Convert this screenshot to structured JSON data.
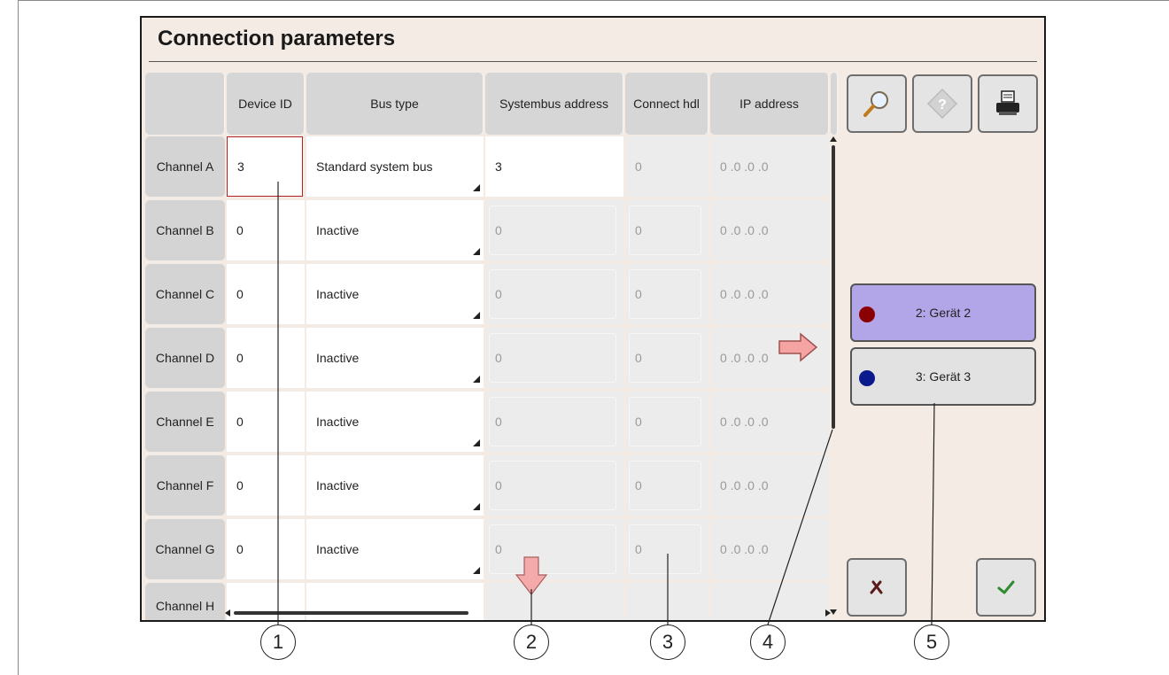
{
  "title": "Connection parameters",
  "columns": [
    "Device ID",
    "Bus type",
    "Systembus address",
    "Connect hdl",
    "IP address"
  ],
  "rows": [
    {
      "channel": "Channel A",
      "device_id": "3",
      "bus_type": "Standard system bus",
      "systembus_address": "3",
      "connect_hdl": "0",
      "ip_address": "0 .0 .0 .0"
    },
    {
      "channel": "Channel B",
      "device_id": "0",
      "bus_type": "Inactive",
      "systembus_address": "0",
      "connect_hdl": "0",
      "ip_address": "0 .0 .0 .0"
    },
    {
      "channel": "Channel C",
      "device_id": "0",
      "bus_type": "Inactive",
      "systembus_address": "0",
      "connect_hdl": "0",
      "ip_address": "0 .0 .0 .0"
    },
    {
      "channel": "Channel D",
      "device_id": "0",
      "bus_type": "Inactive",
      "systembus_address": "0",
      "connect_hdl": "0",
      "ip_address": "0 .0 .0 .0"
    },
    {
      "channel": "Channel E",
      "device_id": "0",
      "bus_type": "Inactive",
      "systembus_address": "0",
      "connect_hdl": "0",
      "ip_address": "0 .0 .0 .0"
    },
    {
      "channel": "Channel F",
      "device_id": "0",
      "bus_type": "Inactive",
      "systembus_address": "0",
      "connect_hdl": "0",
      "ip_address": "0 .0 .0 .0"
    },
    {
      "channel": "Channel G",
      "device_id": "0",
      "bus_type": "Inactive",
      "systembus_address": "0",
      "connect_hdl": "0",
      "ip_address": "0 .0 .0 .0"
    },
    {
      "channel": "Channel H",
      "device_id": "",
      "bus_type": "",
      "systembus_address": "",
      "connect_hdl": "",
      "ip_address": ""
    }
  ],
  "toolbar": {
    "icons": [
      "magnifier-icon",
      "help-icon",
      "print-icon"
    ]
  },
  "devices": [
    {
      "label": "2: Gerät 2",
      "dot_color": "#8b0000",
      "selected": true
    },
    {
      "label": "3: Gerät 3",
      "dot_color": "#0a1a8c",
      "selected": false
    }
  ],
  "actions": {
    "cancel_icon": "cross-icon",
    "ok_icon": "checkmark-icon"
  },
  "callouts": [
    "1",
    "2",
    "3",
    "4",
    "5"
  ],
  "colors": {
    "selected_border": "#b22222",
    "arrow_fill": "#f5a3a3",
    "device_selected": "#b3a6e8"
  }
}
